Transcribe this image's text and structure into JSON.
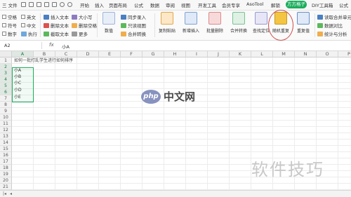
{
  "menubar": {
    "left_menu": "三 文件",
    "items": [
      "开始",
      "插入",
      "页面布局",
      "公式",
      "数据",
      "审阅",
      "视图",
      "开发工具",
      "会员专享",
      "AsoTool",
      "解锁",
      "方方格子",
      "DIY工具箱",
      "公式"
    ],
    "active_item": "方方格子"
  },
  "ribbon": {
    "checks": [
      "空格",
      "英文",
      "符号",
      "数字",
      "中文",
      "执行"
    ],
    "left_buttons": [
      "插入文本",
      "删除文本",
      "截取文本",
      "删除空格",
      "更多"
    ],
    "mid_buttons": [
      "大小写",
      "只保留",
      "数值",
      "同步录入",
      "只读视图",
      "数值录入",
      "合并转换"
    ],
    "big_buttons": [
      "复制粘贴",
      "新增插入",
      "批量删除",
      "合并转换",
      "查找定位",
      "随机重复",
      "重复值",
      "提取单元格内容"
    ],
    "highlighted_button": "随机重复",
    "right_buttons": [
      "读取合并单元格",
      "数据对比",
      "统计与分析"
    ]
  },
  "formula_bar": {
    "name_box": "A2",
    "fx": "fx",
    "value": "小A"
  },
  "grid": {
    "columns": [
      "A",
      "B",
      "C",
      "D",
      "E",
      "F",
      "G",
      "H",
      "I",
      "J",
      "K",
      "L",
      "M",
      "N",
      "O",
      "P"
    ],
    "selected_column": "A",
    "rows": [
      "1",
      "2",
      "3",
      "4",
      "5",
      "6",
      "7",
      "8",
      "9",
      "10",
      "11",
      "12",
      "13",
      "14",
      "15",
      "16",
      "17",
      "18",
      "19",
      "20",
      "21"
    ],
    "selected_rows": [
      "2",
      "3",
      "4",
      "5",
      "6"
    ],
    "cells": {
      "a1": "如何一批打乱学生进行如何排序",
      "a2": "小A",
      "a3": "小B",
      "a4": "小C",
      "a5": "小D",
      "a6": "小E"
    }
  },
  "watermarks": {
    "php_logo": "php",
    "php_text": "中文网",
    "corner_text": "软件技巧"
  },
  "colors": {
    "accent": "#1aad5b",
    "highlight_circle": "#d04a4a"
  }
}
